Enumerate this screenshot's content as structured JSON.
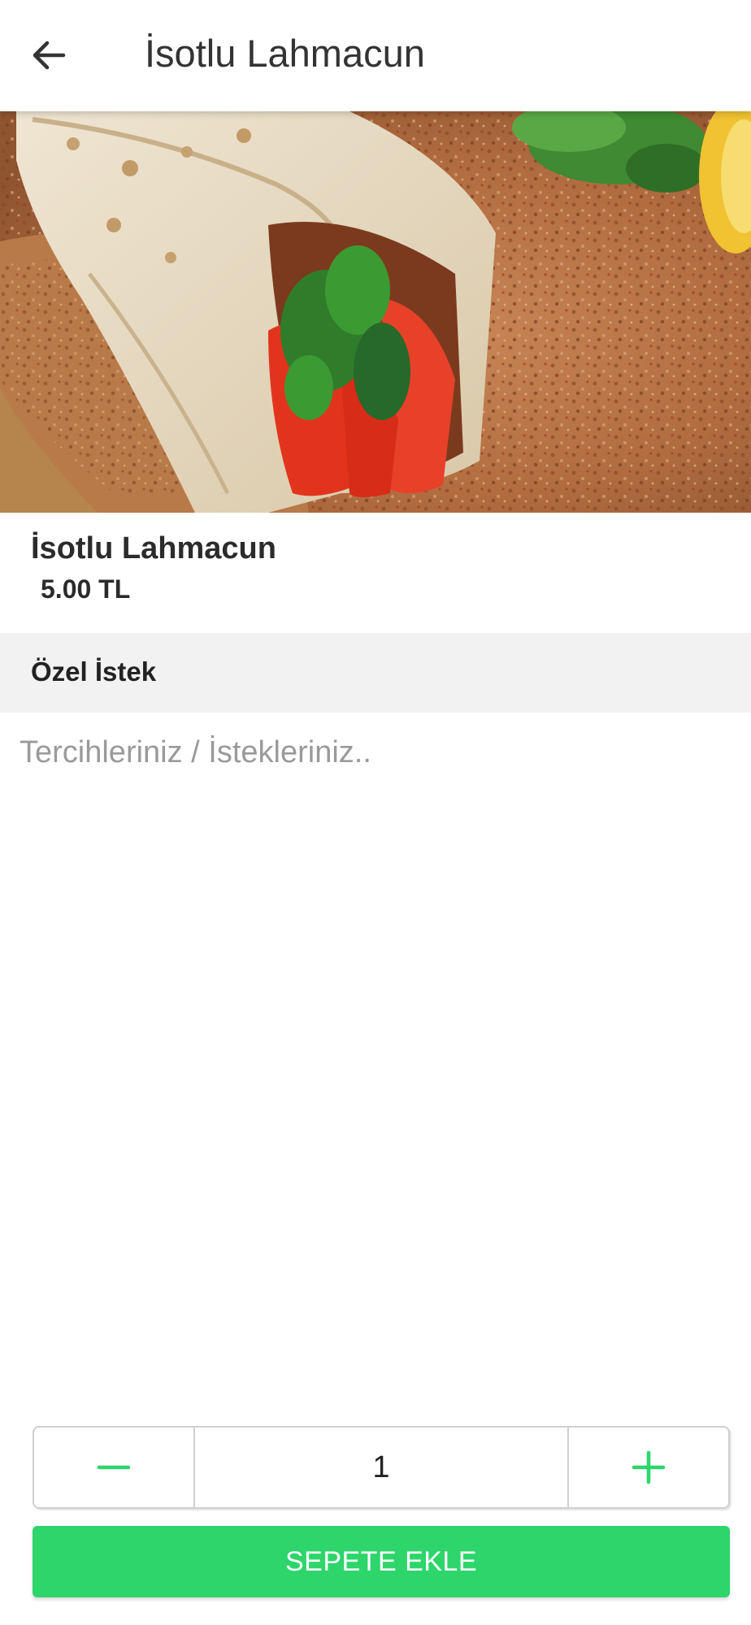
{
  "theme": {
    "accent": "#2dd56b",
    "header_text": "#333333",
    "section_bg": "#f2f2f2"
  },
  "header": {
    "back_icon": "arrow-left-icon",
    "title": "İsotlu Lahmacun"
  },
  "hero": {
    "image": "lahmacun-photo"
  },
  "product": {
    "name": "İsotlu Lahmacun",
    "price": "5.00 TL"
  },
  "special_request": {
    "title": "Özel İstek",
    "placeholder": "Tercihleriniz / İstekleriniz..",
    "value": ""
  },
  "quantity": {
    "decrement_icon": "minus-icon",
    "value": "1",
    "increment_icon": "plus-icon"
  },
  "cart_button": {
    "label": "SEPETE EKLE"
  }
}
